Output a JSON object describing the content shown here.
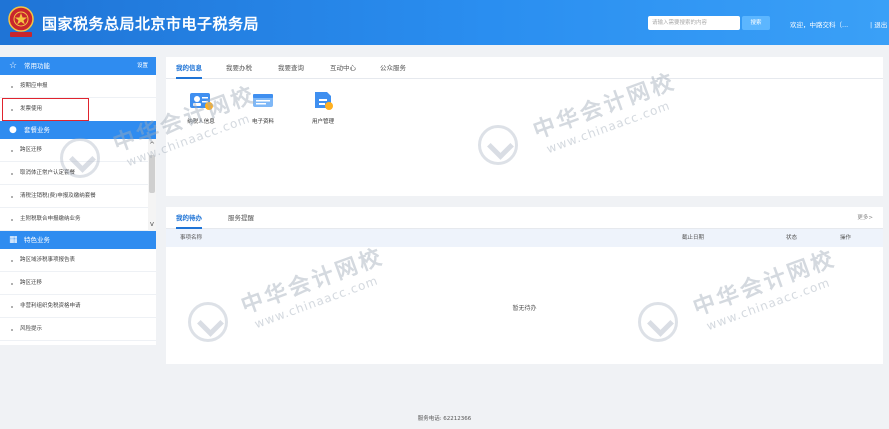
{
  "header": {
    "title": "国家税务总局北京市电子税务局",
    "search_placeholder": "请输入需要搜索的内容",
    "search_button": "搜索",
    "welcome": "欢迎，中路交科（...",
    "logout": "| 退出"
  },
  "sidebar": {
    "common": {
      "title": "常用功能",
      "action": "设置",
      "items": [
        "按期应申报",
        "发票使用"
      ]
    },
    "tax_business": {
      "title": "套餐业务",
      "items": [
        "跨区迁移",
        "取消体正常户认定套餐",
        "清税注销税(费)申报及缴纳套餐",
        "主附税联合申报缴纳业务"
      ]
    },
    "special": {
      "title": "特色业务",
      "items": [
        "跨区域涉税事项报告表",
        "跨区迁移",
        "非营利组织免税资格申请",
        "风险提示"
      ]
    }
  },
  "top_panel": {
    "tabs": [
      "我的信息",
      "我要办税",
      "我要查询",
      "互动中心",
      "公众服务"
    ],
    "quick_items": [
      "纳税人信息",
      "电子资料",
      "用户管理"
    ]
  },
  "bottom_panel": {
    "tabs": [
      "我的待办",
      "服务提醒"
    ],
    "more": "更多>",
    "columns": [
      "事项名称",
      "截止日期",
      "状态",
      "操作"
    ],
    "empty": "暂无待办"
  },
  "footer": {
    "service_phone": "服务电话: 62212366"
  },
  "watermark": {
    "cn": "中华会计网校",
    "en": "www.chinaacc.com"
  },
  "colors": {
    "header_blue": "#1f74d6",
    "section_blue": "#2f8cf0",
    "highlight_red": "#e0242e"
  }
}
